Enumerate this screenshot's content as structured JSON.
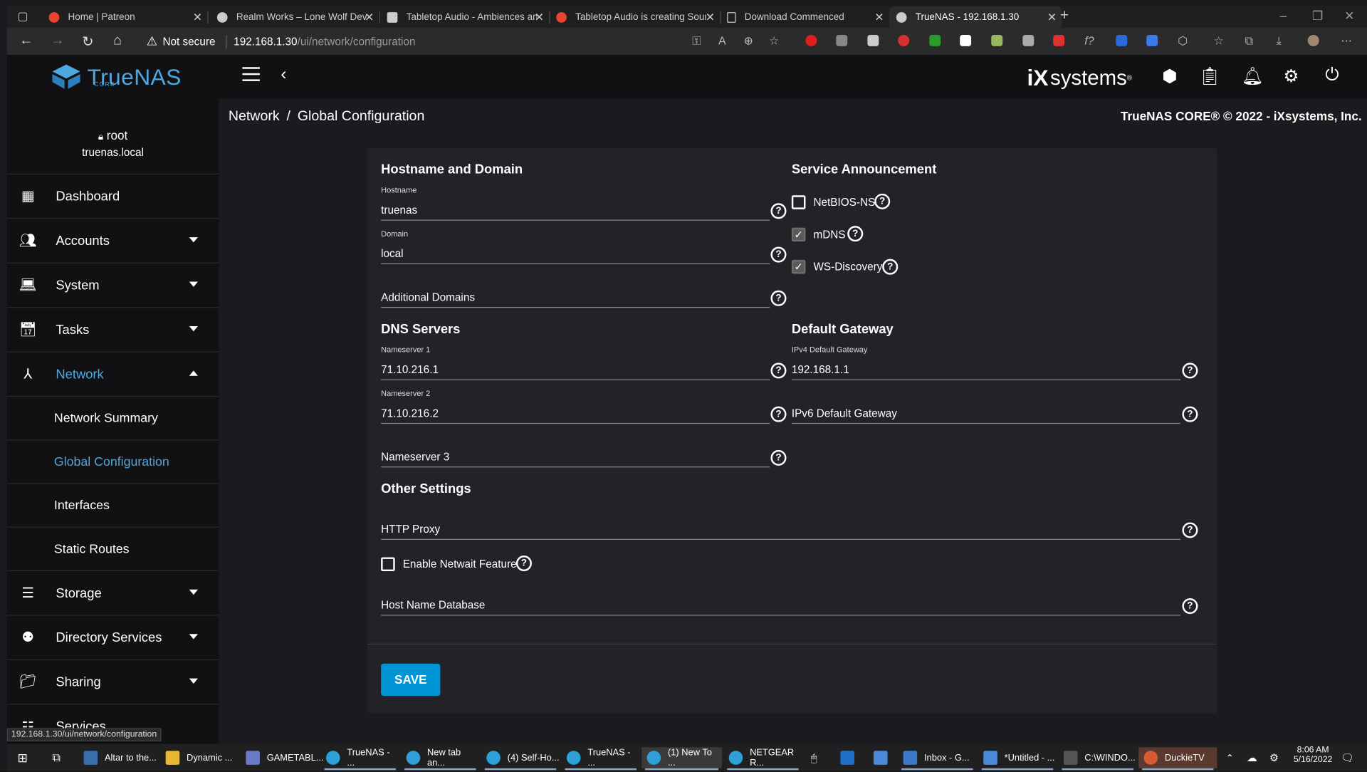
{
  "browser": {
    "tabs": [
      {
        "title": "Home | Patreon",
        "icon_color": "#e8442e"
      },
      {
        "title": "Realm Works – Lone Wolf Devel",
        "icon_color": "#cccccc"
      },
      {
        "title": "Tabletop Audio - Ambiences and",
        "icon_color": "#cccccc"
      },
      {
        "title": "Tabletop Audio is creating Sound",
        "icon_color": "#e8442e"
      },
      {
        "title": "Download Commenced",
        "icon_color": "#cccccc"
      },
      {
        "title": "TrueNAS - 192.168.1.30",
        "icon_color": "#cccccc"
      }
    ],
    "address": {
      "security": "Not secure",
      "host": "192.168.1.30",
      "path": "/ui/network/configuration"
    },
    "status_url": "192.168.1.30/ui/network/configuration"
  },
  "app": {
    "logo_text": "TrueNAS",
    "logo_sub": "CORE",
    "vendor": "iXsystems",
    "accent": "#4ea8e0"
  },
  "sidebar": {
    "user": "root",
    "host": "truenas.local",
    "items": [
      {
        "label": "Dashboard",
        "icon": "dashboard-icon"
      },
      {
        "label": "Accounts",
        "icon": "people-icon"
      },
      {
        "label": "System",
        "icon": "laptop-icon"
      },
      {
        "label": "Tasks",
        "icon": "calendar-icon"
      },
      {
        "label": "Network",
        "icon": "network-icon"
      },
      {
        "label": "Storage",
        "icon": "storage-icon"
      },
      {
        "label": "Directory Services",
        "icon": "directory-icon"
      },
      {
        "label": "Sharing",
        "icon": "sharing-icon"
      },
      {
        "label": "Services",
        "icon": "tune-icon"
      }
    ],
    "network_sub": [
      "Network Summary",
      "Global Configuration",
      "Interfaces",
      "Static Routes"
    ]
  },
  "header": {
    "crumb_parent": "Network",
    "crumb_current": "Global Configuration",
    "copyright": "TrueNAS CORE® © 2022 - iXsystems, Inc."
  },
  "form": {
    "hostname_domain_title": "Hostname and Domain",
    "hostname_label": "Hostname",
    "hostname_value": "truenas",
    "domain_label": "Domain",
    "domain_value": "local",
    "additional_domains": "Additional Domains",
    "service_title": "Service Announcement",
    "netbios": "NetBIOS-NS",
    "mdns": "mDNS",
    "wsd": "WS-Discovery",
    "dns_title": "DNS Servers",
    "ns1_label": "Nameserver 1",
    "ns1_value": "71.10.216.1",
    "ns2_label": "Nameserver 2",
    "ns2_value": "71.10.216.2",
    "ns3": "Nameserver 3",
    "gateway_title": "Default Gateway",
    "ipv4_label": "IPv4 Default Gateway",
    "ipv4_value": "192.168.1.1",
    "ipv6": "IPv6 Default Gateway",
    "other_title": "Other Settings",
    "http_proxy": "HTTP Proxy",
    "netwait": "Enable Netwait Feature",
    "hostdb": "Host Name Database",
    "save": "SAVE",
    "checkbox_state": {
      "netbios": false,
      "mdns": true,
      "wsd": true,
      "netwait": false
    }
  },
  "taskbar": {
    "items": [
      {
        "label": "Altar to the...",
        "icon_color": "#3a6ea8"
      },
      {
        "label": "Dynamic ...",
        "icon_color": "#e8b830"
      },
      {
        "label": "GAMETABL...",
        "icon_color": "#6a7ac8"
      },
      {
        "label": "TrueNAS - ...",
        "icon_color": "#2f9fd8"
      },
      {
        "label": "New tab an...",
        "icon_color": "#2f9fd8"
      },
      {
        "label": "(4) Self-Ho...",
        "icon_color": "#2f9fd8"
      },
      {
        "label": "TrueNAS - ...",
        "icon_color": "#2f9fd8"
      },
      {
        "label": "(1) New To ...",
        "icon_color": "#2f9fd8"
      },
      {
        "label": "NETGEAR R...",
        "icon_color": "#2f9fd8"
      },
      {
        "label": "Inbox - G...",
        "icon_color": "#3a78c8"
      },
      {
        "label": "*Untitled - ...",
        "icon_color": "#4a8ad8"
      },
      {
        "label": "C:\\WINDO...",
        "icon_color": "#555555"
      },
      {
        "label": "DuckieTV",
        "icon_color": "#d85a30"
      }
    ],
    "time": "8:06 AM",
    "date": "5/16/2022"
  }
}
